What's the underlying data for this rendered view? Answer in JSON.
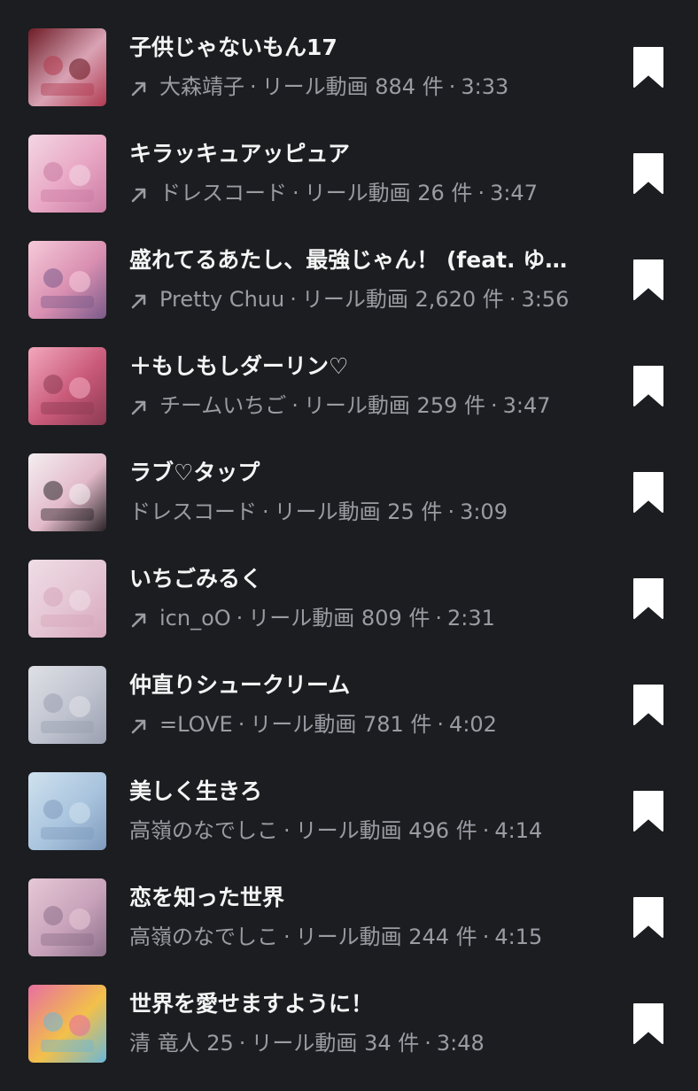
{
  "tracks": [
    {
      "title": "子供じゃないもん17",
      "artist": "大森靖子",
      "reels": "リール動画 884 件",
      "duration": "3:33",
      "arrow": true,
      "colors": [
        "#6e1d27",
        "#d9a3b5",
        "#b23a4f"
      ]
    },
    {
      "title": "キラッキュアッピュア",
      "artist": "ドレスコード",
      "reels": "リール動画 26 件",
      "duration": "3:47",
      "arrow": true,
      "colors": [
        "#f3d6e2",
        "#e8a6c4",
        "#c97aa1"
      ]
    },
    {
      "title": "盛れてるあたし、最強じゃん！ (feat. ゆ…",
      "artist": "Pretty Chuu",
      "reels": "リール動画 2,620 件",
      "duration": "3:56",
      "arrow": true,
      "colors": [
        "#f6c9d8",
        "#d98fb1",
        "#7a5a8a"
      ]
    },
    {
      "title": "＋もしもしダーリン♡",
      "artist": "チームいちご",
      "reels": "リール動画 259 件",
      "duration": "3:47",
      "arrow": true,
      "colors": [
        "#f2a7bd",
        "#c95a79",
        "#8c3a52"
      ]
    },
    {
      "title": "ラブ♡タップ",
      "artist": "ドレスコード",
      "reels": "リール動画 25 件",
      "duration": "3:09",
      "arrow": false,
      "colors": [
        "#f4eef0",
        "#e2b9c9",
        "#2a2428"
      ]
    },
    {
      "title": "いちごみるく",
      "artist": "icn_oO",
      "reels": "リール動画 809 件",
      "duration": "2:31",
      "arrow": true,
      "colors": [
        "#efdde6",
        "#e4c4d2",
        "#d6a6bb"
      ]
    },
    {
      "title": "仲直りシュークリーム",
      "artist": "=LOVE",
      "reels": "リール動画 781 件",
      "duration": "4:02",
      "arrow": true,
      "colors": [
        "#dfe0e6",
        "#bfc3cf",
        "#9a9fb0"
      ]
    },
    {
      "title": "美しく生きろ",
      "artist": "高嶺のなでしこ",
      "reels": "リール動画 496 件",
      "duration": "4:14",
      "arrow": false,
      "colors": [
        "#cfe1ee",
        "#a9c4de",
        "#7f9bbd"
      ]
    },
    {
      "title": "恋を知った世界",
      "artist": "高嶺のなでしこ",
      "reels": "リール動画 244 件",
      "duration": "4:15",
      "arrow": false,
      "colors": [
        "#e6c8d6",
        "#c8a2ba",
        "#8c6f8a"
      ]
    },
    {
      "title": "世界を愛せますように！",
      "artist": "清 竜人 25",
      "reels": "リール動画 34 件",
      "duration": "3:48",
      "arrow": false,
      "colors": [
        "#e86fa0",
        "#f2c04a",
        "#6ab8d9"
      ]
    }
  ],
  "separator": "·"
}
